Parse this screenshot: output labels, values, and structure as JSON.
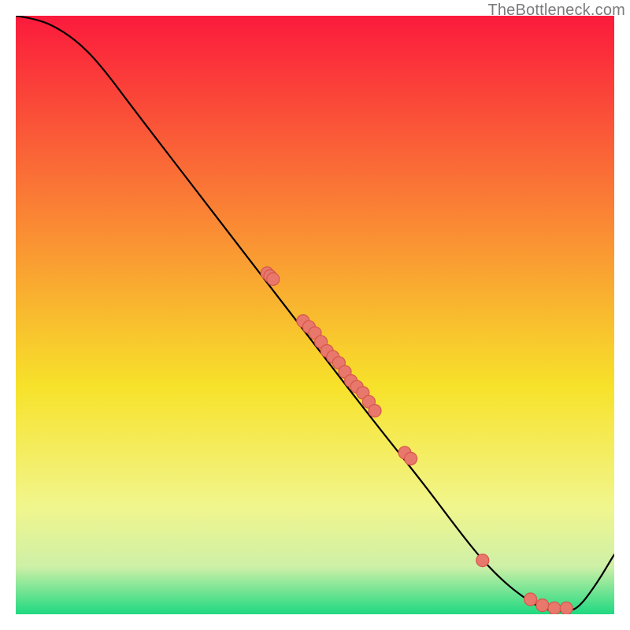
{
  "watermark": "TheBottleneck.com",
  "colors": {
    "gradient_top": "#fb1a3c",
    "gradient_mid1": "#fa8a34",
    "gradient_mid2": "#f7e22a",
    "gradient_mid3": "#f1f68d",
    "gradient_mid4": "#cef0a7",
    "gradient_bottom": "#1fd981",
    "dot_fill": "#e8776c",
    "dot_stroke": "#d6574a",
    "curve_stroke": "#000000"
  },
  "chart_data": {
    "type": "line",
    "title": "",
    "xlabel": "",
    "ylabel": "",
    "xlim": [
      0,
      100
    ],
    "ylim": [
      0,
      100
    ],
    "grid": false,
    "legend": false,
    "series": [
      {
        "name": "bottleneck-curve",
        "x": [
          0,
          3,
          6,
          10,
          14,
          20,
          30,
          40,
          50,
          60,
          68,
          74,
          78,
          82,
          86,
          88,
          90,
          92,
          94,
          97,
          100
        ],
        "y": [
          100,
          99.5,
          98.5,
          96,
          92,
          84,
          71,
          58,
          45,
          32,
          22,
          14,
          9,
          5,
          2,
          1,
          0.5,
          0.5,
          1,
          5,
          10
        ]
      }
    ],
    "points": {
      "name": "markers",
      "x": [
        42,
        42.5,
        43,
        48,
        49,
        50,
        51,
        52,
        53,
        54,
        55,
        56,
        57,
        58,
        59,
        60,
        65,
        66,
        78,
        86,
        88,
        90,
        92
      ],
      "y": [
        57,
        56.5,
        56,
        49,
        48,
        47,
        45.5,
        44,
        43,
        42,
        40.5,
        39,
        38,
        37,
        35.5,
        34,
        27,
        26,
        9,
        2.5,
        1.5,
        1,
        1
      ]
    }
  }
}
